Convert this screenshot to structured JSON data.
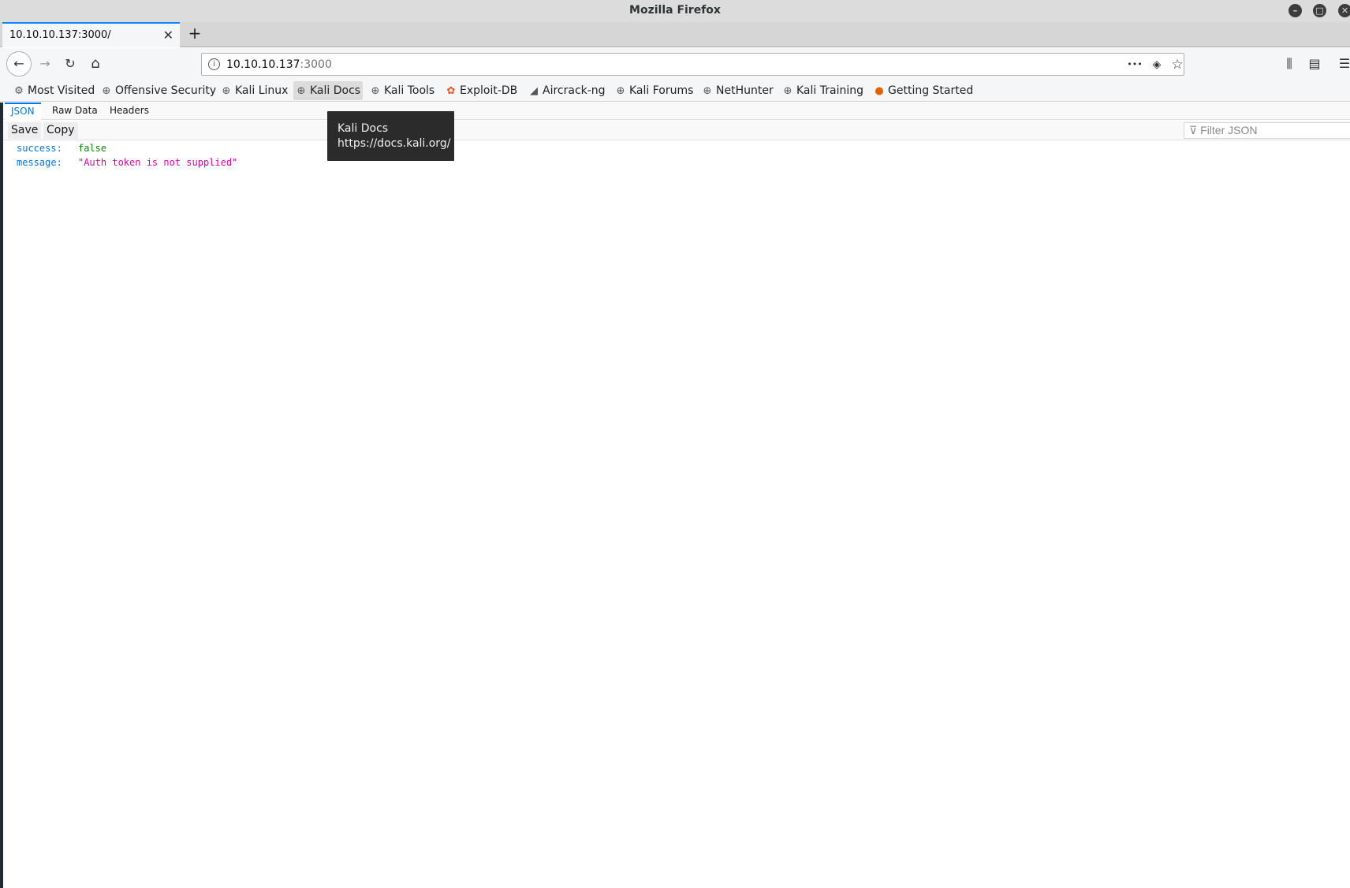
{
  "window": {
    "title": "Mozilla Firefox"
  },
  "tab": {
    "label": "10.10.10.137:3000/",
    "close": "✕",
    "new_tab": "+"
  },
  "nav": {
    "back": "←",
    "forward": "→",
    "reload": "↻",
    "home": "⌂",
    "url_host": "10.10.10.137",
    "url_port": ":3000",
    "page_actions": "•••",
    "pocket": "◈",
    "bookmark_star": "☆",
    "library": "⫼",
    "sidebar": "▤",
    "menu": "☰"
  },
  "bookmarks": [
    {
      "label": "Most Visited",
      "icon": "gear-icon"
    },
    {
      "label": "Offensive Security",
      "icon": "globe-icon"
    },
    {
      "label": "Kali Linux",
      "icon": "globe-icon"
    },
    {
      "label": "Kali Docs",
      "icon": "globe-icon"
    },
    {
      "label": "Kali Tools",
      "icon": "globe-icon"
    },
    {
      "label": "Exploit-DB",
      "icon": "exploitdb-icon"
    },
    {
      "label": "Aircrack-ng",
      "icon": "aircrack-icon"
    },
    {
      "label": "Kali Forums",
      "icon": "globe-icon"
    },
    {
      "label": "NetHunter",
      "icon": "globe-icon"
    },
    {
      "label": "Kali Training",
      "icon": "globe-icon"
    },
    {
      "label": "Getting Started",
      "icon": "firefox-icon"
    }
  ],
  "viewer": {
    "tabs": [
      "JSON",
      "Raw Data",
      "Headers"
    ],
    "save": "Save",
    "copy": "Copy",
    "filter_placeholder": "⊽ Filter JSON"
  },
  "json": {
    "rows": [
      {
        "key": "success:",
        "value": "false"
      },
      {
        "key": "message:",
        "value": "\"Auth token is not supplied\""
      }
    ]
  },
  "tooltip": {
    "title": "Kali Docs",
    "url": "https://docs.kali.org/"
  },
  "colors": {
    "accent": "#0a84ff",
    "json_key": "#0074e8",
    "json_bool": "#058b00",
    "json_string": "#dd00a9"
  }
}
